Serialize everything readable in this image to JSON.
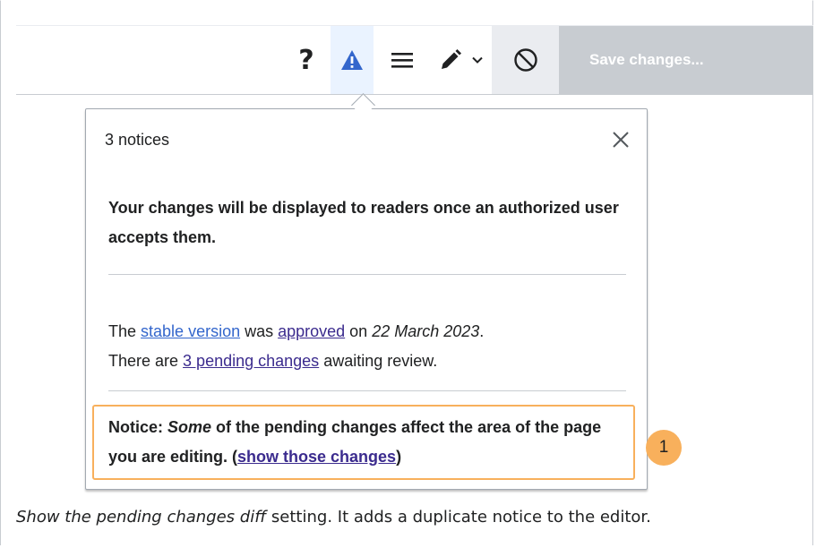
{
  "toolbar": {
    "help_label": "?",
    "save_label": "Save changes...",
    "icons": {
      "help": "help-icon",
      "notices": "alert-icon",
      "menu": "hamburger-icon",
      "edit": "pencil-icon",
      "dropdown": "chevron-down-icon",
      "cancel": "cancel-icon"
    },
    "colors": {
      "alert": "#3366cc",
      "active_bg": "#eaf3ff",
      "save_bg": "#c8ccd1"
    }
  },
  "popup": {
    "header": "3 notices",
    "close_icon": "close-icon",
    "notice1": "Your changes will be displayed to readers once an authorized user accepts them.",
    "notice2": {
      "p1": "The ",
      "stable_link": "stable version",
      "p2": " was ",
      "approved_link": "approved",
      "p3": " on ",
      "date": "22 March 2023",
      "p4": ".",
      "p5": "There are ",
      "pending_link": "3 pending changes",
      "p6": " awaiting review."
    },
    "notice3": {
      "prefix": "Notice: ",
      "emph": "Some",
      "text": " of the pending changes affect the area of the page you are editing. (",
      "link": "show those changes",
      "suffix": ")"
    }
  },
  "annotation": {
    "badge": "1",
    "color": "#f8b05c"
  },
  "caption": {
    "emph": "Show the pending changes diff",
    "text": " setting. It adds a duplicate notice to the editor."
  }
}
